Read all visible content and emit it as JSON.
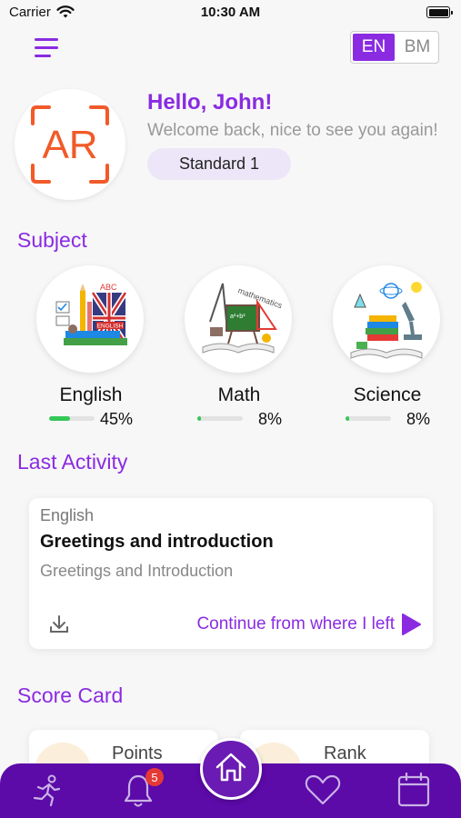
{
  "status_bar": {
    "carrier": "Carrier",
    "time": "10:30 AM"
  },
  "header": {
    "languages": [
      "EN",
      "BM"
    ],
    "active_language": "EN"
  },
  "profile": {
    "initials": "AR",
    "greeting": "Hello, John!",
    "welcome": "Welcome back, nice to see you again!",
    "standard": "Standard 1"
  },
  "subject_section": {
    "title": "Subject",
    "subjects": [
      {
        "name": "English",
        "progress_label": "45%",
        "progress": 0.45
      },
      {
        "name": "Math",
        "progress_label": "8%",
        "progress": 0.08
      },
      {
        "name": "Science",
        "progress_label": "8%",
        "progress": 0.08
      }
    ]
  },
  "last_activity": {
    "title": "Last Activity",
    "subject": "English",
    "lesson_title": "Greetings and introduction",
    "lesson_subtitle": "Greetings and Introduction",
    "continue_label": "Continue from where I left"
  },
  "score_card": {
    "title": "Score Card",
    "cards": [
      {
        "label": "Points"
      },
      {
        "label": "Rank"
      }
    ]
  },
  "bottom_nav": {
    "notification_count": "5",
    "items": [
      "activity-icon",
      "bell-icon",
      "home-icon",
      "heart-icon",
      "calendar-icon"
    ]
  },
  "colors": {
    "primary": "#8a2be2",
    "nav": "#5c0aa8",
    "accent_orange": "#f15a29",
    "progress_green": "#34c759"
  }
}
